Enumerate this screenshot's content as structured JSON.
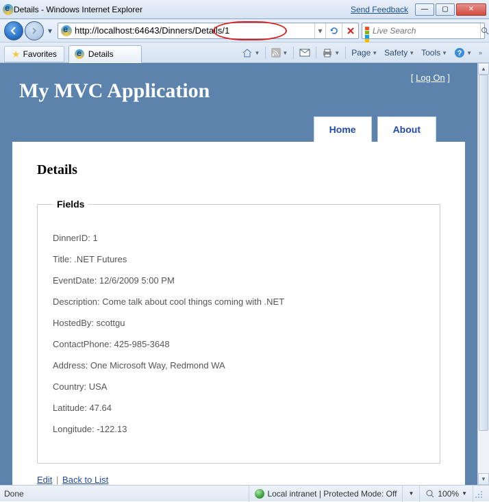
{
  "window": {
    "title": "Details - Windows Internet Explorer",
    "feedback": "Send Feedback"
  },
  "nav": {
    "url": "http://localhost:64643/Dinners/Details/1",
    "search_placeholder": "Live Search"
  },
  "tabs": {
    "favorites_label": "Favorites",
    "tab_title": "Details"
  },
  "toolbar": {
    "page": "Page",
    "safety": "Safety",
    "tools": "Tools"
  },
  "page": {
    "logon_label": "Log On",
    "app_title": "My MVC Application",
    "nav_home": "Home",
    "nav_about": "About",
    "heading": "Details",
    "legend": "Fields",
    "fields": {
      "dinner_id": "DinnerID: 1",
      "title": "Title: .NET Futures",
      "event_date": "EventDate: 12/6/2009 5:00 PM",
      "description": "Description: Come talk about cool things coming with .NET",
      "hosted_by": "HostedBy: scottgu",
      "contact_phone": "ContactPhone: 425-985-3648",
      "address": "Address: One Microsoft Way, Redmond WA",
      "country": "Country: USA",
      "latitude": "Latitude: 47.64",
      "longitude": "Longitude: -122.13"
    },
    "edit_link": "Edit",
    "back_link": "Back to List"
  },
  "status": {
    "left": "Done",
    "zone": "Local intranet | Protected Mode: Off",
    "zoom": "100%"
  }
}
